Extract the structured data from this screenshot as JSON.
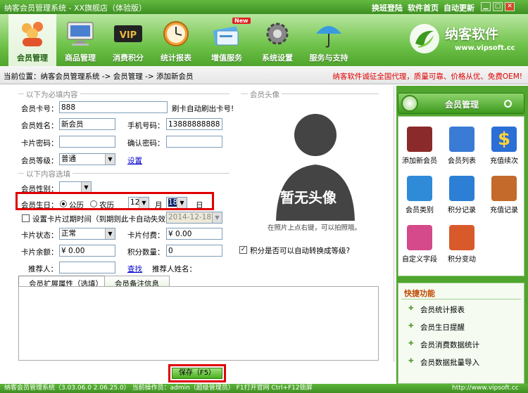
{
  "titlebar": {
    "title": "纳客会员管理系统 - XX旗舰店（体验版）",
    "links": [
      "换班登陆",
      "软件首页",
      "自动更新"
    ]
  },
  "nav": [
    {
      "label": "会员管理",
      "icon": "members-icon",
      "active": true
    },
    {
      "label": "商品管理",
      "icon": "computer-icon",
      "active": false
    },
    {
      "label": "消费积分",
      "icon": "vip-icon",
      "active": false
    },
    {
      "label": "统计报表",
      "icon": "clock-icon",
      "active": false
    },
    {
      "label": "增值服务",
      "icon": "card-icon",
      "active": false,
      "badge": "New"
    },
    {
      "label": "系统设置",
      "icon": "gear-icon",
      "active": false
    },
    {
      "label": "服务与支持",
      "icon": "umbrella-icon",
      "active": false
    }
  ],
  "logo": {
    "name": "纳客软件",
    "url": "www.vipsoft.cc"
  },
  "breadcrumb": "当前位置：纳客会员管理系统 -> 会员管理 -> 添加新会员",
  "notice": "纳客软件诚征全国代理，质量可靠、价格从优、免费OEM!",
  "form": {
    "group_required": "以下为必填内容",
    "card_no_label": "会员卡号：",
    "card_no": "888",
    "card_hint": "刷卡自动刷出卡号!",
    "name_label": "会员姓名：",
    "name": "新会员",
    "phone_label": "手机号码：",
    "phone": "13888888888",
    "pwd_label": "卡片密码：",
    "pwd_confirm_label": "确认密码：",
    "level_label": "会员等级：",
    "level": "普通",
    "settings_link": "设置",
    "group_optional": "以下内容选填",
    "gender_label": "会员性别：",
    "birthday_label": "会员生日：",
    "solar": "公历",
    "lunar": "农历",
    "month": "12",
    "month_unit": "月",
    "day": "18",
    "day_unit": "日",
    "expiry_label": "设置卡片过期时间（到期则此卡自动失效）",
    "expiry_date": "2014-12-18",
    "status_label": "卡片状态：",
    "status": "正常",
    "fee_label": "卡片付费：",
    "fee": "¥ 0.00",
    "balance_label": "卡片余额：",
    "balance": "¥ 0.00",
    "points_label": "积分数量：",
    "points": "0",
    "auto_level": "积分是否可以自动转换成等级?",
    "referrer_label": "推荐人：",
    "find_link": "查找",
    "referrer_name_label": "推荐人姓名："
  },
  "avatar": {
    "group": "会员头像",
    "text": "暂无头像",
    "hint": "在照片上点右键，可以拍照哦。"
  },
  "tabs": [
    "会员扩展属性（选填）",
    "会员备注信息"
  ],
  "save_label": "保存（F5）",
  "status_bar": "纳客会员管理系统（3.03.06.0 2.06.25.0）  当前操作员：admin（超级管理员）  F1打开官网  Ctrl+F12锁屏",
  "status_url": "http://www.vipsoft.cc",
  "panel": {
    "title": "会员管理",
    "items": [
      {
        "label": "添加新会员",
        "icon": "add-member-icon",
        "color": "#8b2a2a"
      },
      {
        "label": "会员列表",
        "icon": "member-list-icon",
        "color": "#3a7bd5"
      },
      {
        "label": "充值续次",
        "icon": "dollar-icon",
        "color": "#2b6fd6"
      },
      {
        "label": "会员类别",
        "icon": "folder-icon",
        "color": "#2f8ad8"
      },
      {
        "label": "积分记录",
        "icon": "truck-icon",
        "color": "#2c7fd4"
      },
      {
        "label": "充值记录",
        "icon": "magnifier-icon",
        "color": "#c46a2a"
      },
      {
        "label": "自定义字段",
        "icon": "fireworks-icon",
        "color": "#d44a8a"
      },
      {
        "label": "积分变动",
        "icon": "refresh-icon",
        "color": "#d85a2a"
      }
    ],
    "quick_title": "快捷功能",
    "quick": [
      "会员统计报表",
      "会员生日提醒",
      "会员消费数据统计",
      "会员数据批量导入"
    ]
  }
}
